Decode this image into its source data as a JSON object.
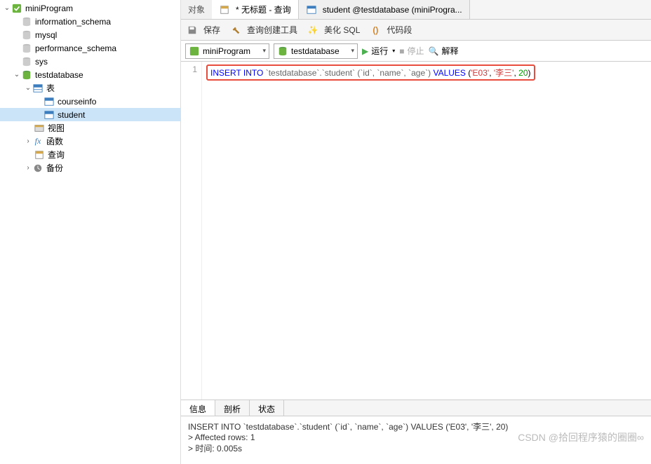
{
  "sidebar": {
    "root": "miniProgram",
    "dbs": [
      "information_schema",
      "mysql",
      "performance_schema",
      "sys"
    ],
    "activeDb": "testdatabase",
    "tablesNode": "表",
    "tables": [
      "courseinfo",
      "student"
    ],
    "views": "视图",
    "functions": "函数",
    "queries": "查询",
    "backups": "备份"
  },
  "tabs": {
    "objects": "对象",
    "query": "* 无标题 - 查询",
    "tableTab": "student @testdatabase (miniProgra..."
  },
  "toolbar": {
    "save": "保存",
    "builder": "查询创建工具",
    "beautify": "美化 SQL",
    "snippet": "代码段"
  },
  "selectors": {
    "conn": "miniProgram",
    "db": "testdatabase",
    "run": "运行",
    "stop": "停止",
    "explain": "解释"
  },
  "editor": {
    "lineNo": "1",
    "sql": {
      "kw1": "INSERT INTO",
      "tbl": " `testdatabase`.`student` (`id`, `name`, `age`) ",
      "kw2": "VALUES",
      "paren1": " (",
      "v1": "'E03'",
      "c1": ", ",
      "v2": "'李三'",
      "c2": ", ",
      "v3": "20",
      "paren2": ")"
    }
  },
  "outputTabs": {
    "info": "信息",
    "profile": "剖析",
    "status": "状态"
  },
  "output": {
    "l1": "INSERT INTO `testdatabase`.`student` (`id`, `name`, `age`) VALUES ('E03', '李三', 20)",
    "l2": "> Affected rows: 1",
    "l3": "> 时间: 0.005s"
  },
  "watermark": "CSDN @拾回程序猿的圈圈∞"
}
